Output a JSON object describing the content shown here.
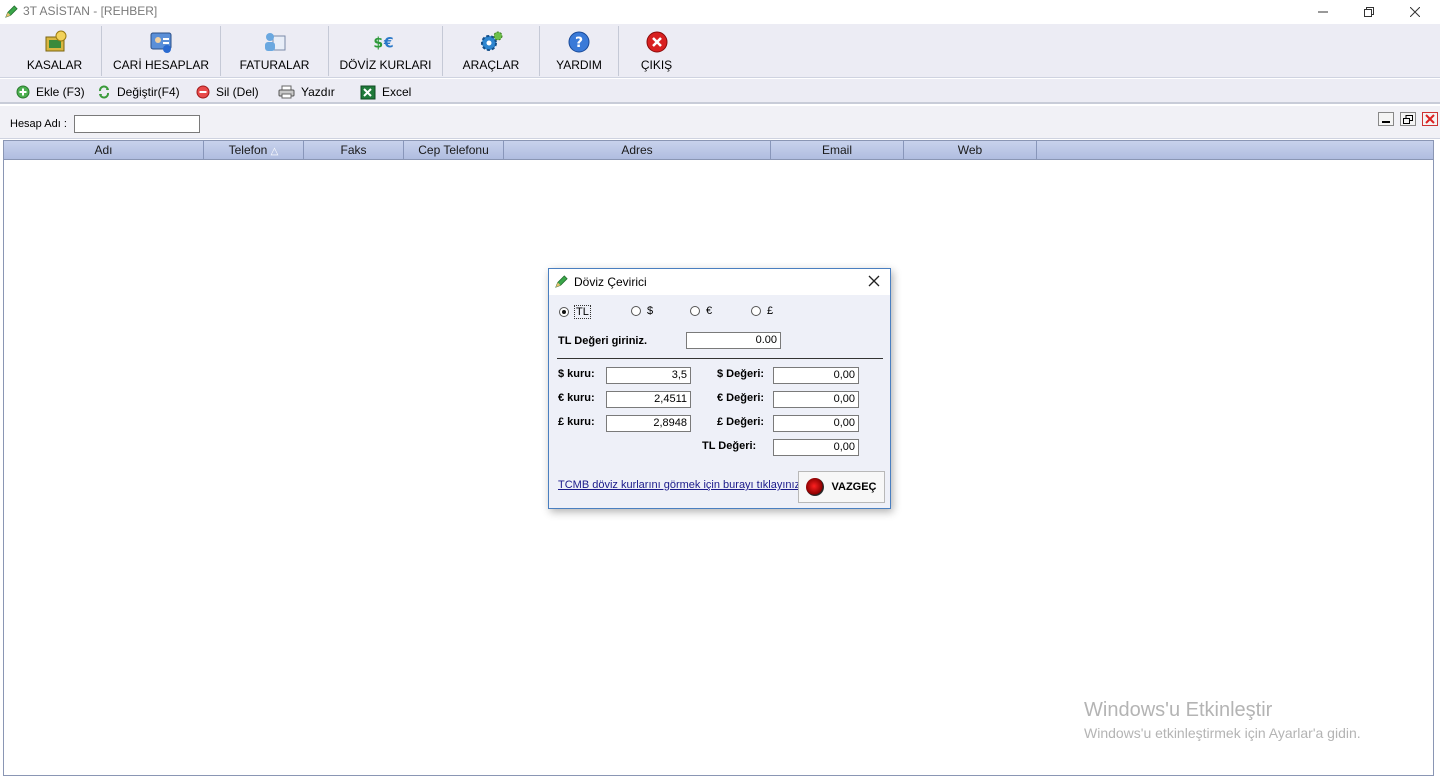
{
  "window": {
    "title": "3T ASİSTAN - [REHBER]"
  },
  "ribbon": {
    "buttons": [
      {
        "label": "KASALAR",
        "icon": "safe-icon"
      },
      {
        "label": "CARİ HESAPLAR",
        "icon": "contact-card-icon"
      },
      {
        "label": "FATURALAR",
        "icon": "invoice-users-icon"
      },
      {
        "label": "DÖVİZ KURLARI",
        "icon": "currency-icon"
      },
      {
        "label": "ARAÇLAR",
        "icon": "gears-icon"
      },
      {
        "label": "YARDIM",
        "icon": "help-icon"
      },
      {
        "label": "ÇIKIŞ",
        "icon": "exit-icon"
      }
    ]
  },
  "toolbar": {
    "add": "Ekle (F3)",
    "edit": "Değiştir(F4)",
    "delete": "Sil (Del)",
    "print": "Yazdır",
    "excel": "Excel"
  },
  "search": {
    "label": "Hesap Adı :",
    "value": ""
  },
  "grid": {
    "columns": [
      "Adı",
      "Telefon",
      "Faks",
      "Cep Telefonu",
      "Adres",
      "Email",
      "Web"
    ],
    "sort_indicator": "△",
    "rows": []
  },
  "dialog": {
    "title": "Döviz Çevirici",
    "currencies": [
      "TL",
      "$",
      "€",
      "£"
    ],
    "selected_currency": "TL",
    "input_label": "TL Değeri giriniz.",
    "input_value": "0.00",
    "rates": [
      {
        "label": "$ kuru:",
        "value": "3,5"
      },
      {
        "label": "€ kuru:",
        "value": "2,4511"
      },
      {
        "label": "£ kuru:",
        "value": "2,8948"
      }
    ],
    "results": [
      {
        "label": "$ Değeri:",
        "value": "0,00"
      },
      {
        "label": "€ Değeri:",
        "value": "0,00"
      },
      {
        "label": "£ Değeri:",
        "value": "0,00"
      },
      {
        "label": "TL Değeri:",
        "value": "0,00"
      }
    ],
    "link": "TCMB döviz kurlarını görmek için burayı tıklayınız.",
    "cancel": "VAZGEÇ"
  },
  "watermark": {
    "line1": "Windows'u Etkinleştir",
    "line2": "Windows'u etkinleştirmek için Ayarlar'a gidin."
  },
  "colors": {
    "accent": "#4a7fc0",
    "grid_header": "#b8c4e4",
    "ribbon_bg": "#ececf4"
  }
}
